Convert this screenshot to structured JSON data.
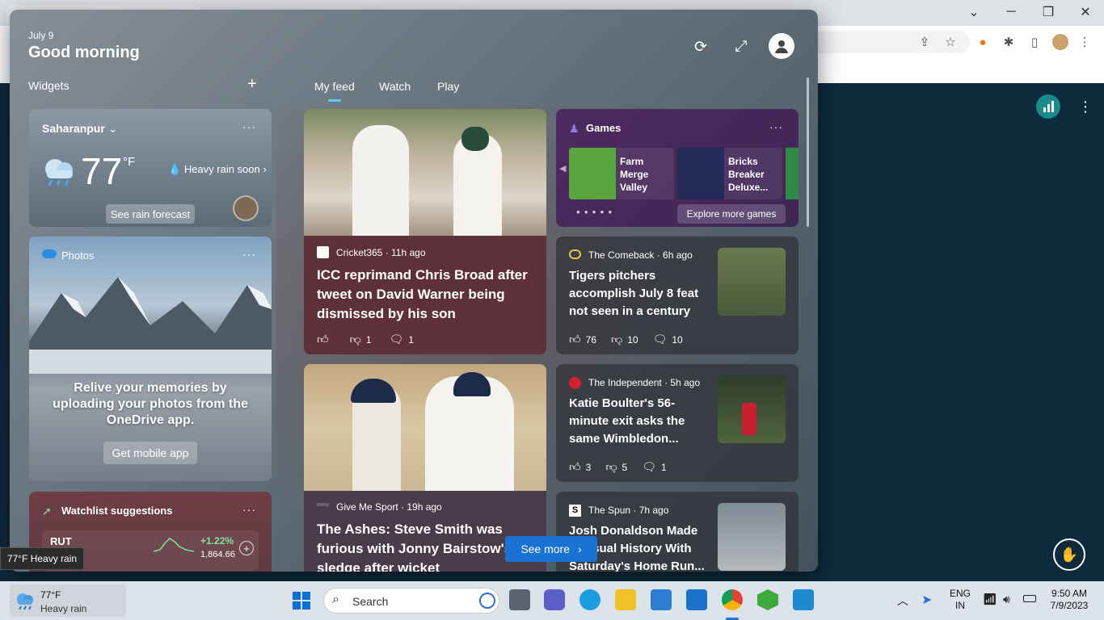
{
  "header": {
    "date": "July 9",
    "greeting": "Good morning"
  },
  "widgets_label": "Widgets",
  "add_label": "+",
  "tabs": [
    "My feed",
    "Watch",
    "Play"
  ],
  "weather": {
    "location": "Saharanpur",
    "temp": "77",
    "unit": "°F",
    "condition": "Heavy rain soon",
    "button": "See rain forecast"
  },
  "photos": {
    "title": "Photos",
    "message": "Relive your memories by uploading your photos from the OneDrive app.",
    "button": "Get mobile app"
  },
  "watchlist": {
    "title": "Watchlist suggestions",
    "symbol": "RUT",
    "change": "+1.22%",
    "price": "1,864.66"
  },
  "news": [
    {
      "source": "Cricket365 · 11h ago",
      "title": "ICC reprimand Chris Broad after tweet on David Warner being dismissed by his son",
      "dislikes": "1",
      "comments": "1"
    },
    {
      "source": "Give Me Sport · 19h ago",
      "title": "The Ashes: Steve Smith was furious with Jonny Bairstow's sledge after wicket"
    }
  ],
  "games": {
    "title": "Games",
    "items": [
      "Farm Merge Valley",
      "Bricks Breaker Deluxe..."
    ],
    "button": "Explore more games"
  },
  "side_news": [
    {
      "source": "The Comeback · 6h ago",
      "title": "Tigers pitchers accomplish July 8 feat not seen in a century",
      "likes": "76",
      "dislikes": "10",
      "comments": "10"
    },
    {
      "source": "The Independent · 5h ago",
      "title": "Katie Boulter's 56-minute exit asks the same Wimbledon...",
      "likes": "3",
      "dislikes": "5",
      "comments": "1"
    },
    {
      "source": "The Spun · 7h ago",
      "title": "Josh Donaldson Made Unusual History With Saturday's Home Run..."
    }
  ],
  "see_more": "See more",
  "tooltip": "77°F Heavy rain",
  "taskbar": {
    "weather_temp": "77°F",
    "weather_cond": "Heavy rain",
    "search_placeholder": "Search",
    "lang": "ENG",
    "region": "IN",
    "time": "9:50 AM",
    "date": "7/9/2023"
  },
  "colors": {
    "accent": "#1a73d2",
    "news_red": "#5e3039",
    "games_purple": "#4d2a60",
    "stock_up": "#7de39a"
  }
}
